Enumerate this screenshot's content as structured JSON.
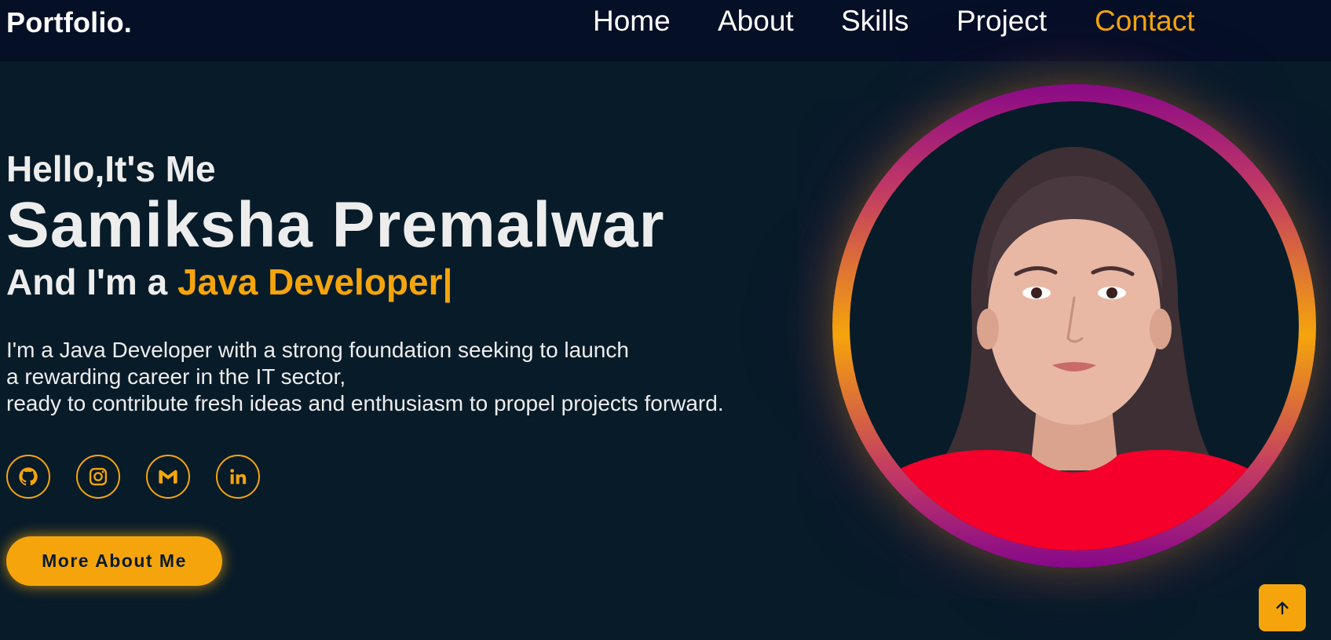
{
  "header": {
    "logo": "Portfolio.",
    "nav": [
      {
        "label": "Home"
      },
      {
        "label": "About"
      },
      {
        "label": "Skills"
      },
      {
        "label": "Project"
      },
      {
        "label": "Contact",
        "active": true
      }
    ]
  },
  "hero": {
    "greeting": "Hello,It's Me",
    "name": "Samiksha Premalwar",
    "role_prefix": "And I'm a ",
    "role_highlight": "Java Developer|",
    "description": [
      "I'm a Java Developer with a strong foundation seeking to launch",
      "a rewarding career in the IT sector,",
      "ready to contribute fresh ideas and enthusiasm to propel projects forward."
    ],
    "social_icons": [
      "github-icon",
      "instagram-icon",
      "gmail-icon",
      "linkedin-icon"
    ],
    "cta_label": "More About Me"
  },
  "scroll_top_icon": "arrow-up-icon",
  "colors": {
    "background": "#081b29",
    "navbar": "#050f26",
    "accent": "#f5a50b",
    "ring_purple": "#8a0a87",
    "text": "#ededed"
  }
}
